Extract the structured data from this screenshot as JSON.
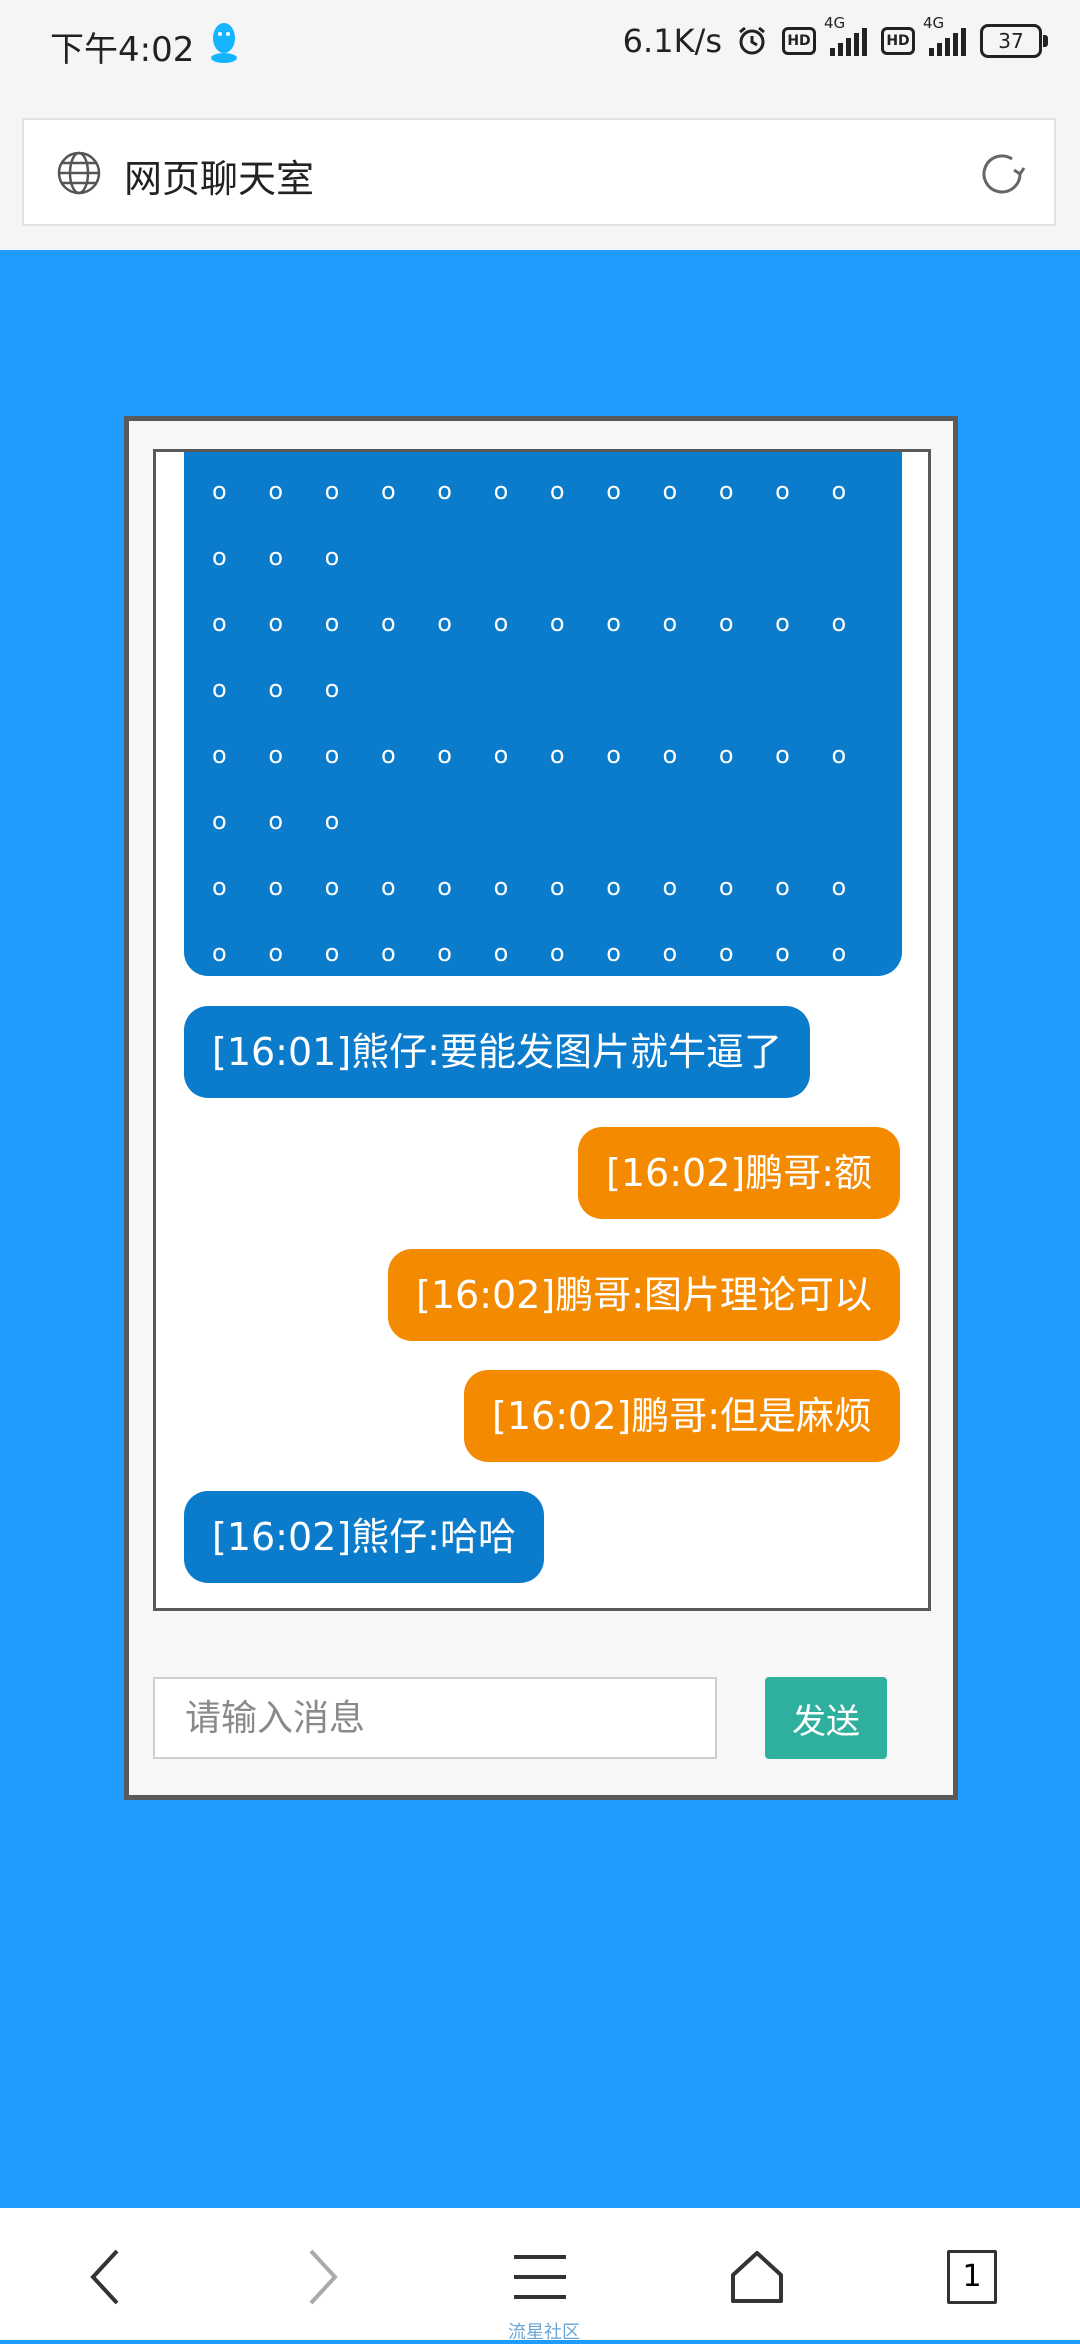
{
  "status_bar": {
    "time": "下午4:02",
    "net_speed": "6.1K/s",
    "hd1": "HD",
    "hd2": "HD",
    "sig1": "4G",
    "sig2": "4G",
    "battery": "37"
  },
  "browser": {
    "page_title": "网页聊天室"
  },
  "chat": {
    "dots_lines": [
      "o o o o o o o o o o o o o o o o o",
      "o o o",
      "o o o o o o o o o o o o o o o o o",
      "o o o",
      "o o o o o o o o o o o o o o o o o",
      "o o o",
      "o o o o o o o o o o o o o o o o o",
      "o o o  o o o o o o o o o o o o o"
    ],
    "messages": [
      {
        "text": "[16:01]熊仔:要能发图片就牛逼了",
        "side": "left"
      },
      {
        "text": "[16:02]鹏哥:额",
        "side": "right"
      },
      {
        "text": "[16:02]鹏哥:图片理论可以",
        "side": "right"
      },
      {
        "text": "[16:02]鹏哥:但是麻烦",
        "side": "right"
      },
      {
        "text": "[16:02]熊仔:哈哈",
        "side": "left"
      }
    ],
    "input_placeholder": "请输入消息",
    "send_label": "发送"
  },
  "nav": {
    "tabs_count": "1",
    "watermark": "流星社区"
  },
  "colors": {
    "background": "#1e9bff",
    "left_bubble": "#0a7ccb",
    "right_bubble": "#f38a00",
    "send_button": "#2fb09f"
  }
}
